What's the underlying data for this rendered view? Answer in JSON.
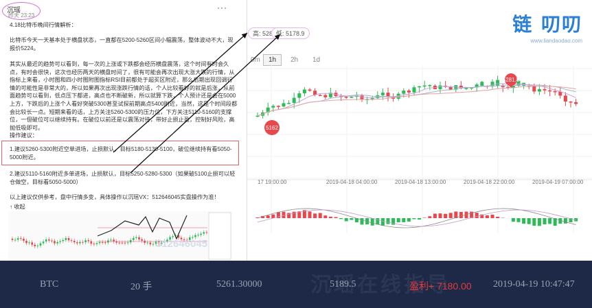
{
  "post": {
    "author": "沉瑶",
    "time": "昨天 23:23",
    "more": "···",
    "title": "4.18比特币晚间行情解析：",
    "para1": "比特币今天一天基本处于横盘状态，一直都在5200-5260区间小幅震荡，整体波动不大，现报价5224。",
    "para2": "其实从最近的趋势可以看到，每一次的上涨或下跌都会经历横盘震荡，这个时间有时会久点，有时会很快，这次也经历两天的横盘时间了，很有可能会再次出现大涨大跌的行情，从指标上来看，小时图和四小时图附图指标RSI目前都处于超买区附近，那么后期出现回调行情的可能性是非常大的，所以如果再次出现涨跌行情的话，个人比较看好的就是后涨，从前面趋势可以看到，低点压下都进，高点也不断破新，所以就算下跌，个人预计还是会在5000上方，下跌后的上涨个人看好突破5300甚至试探前期高点5400附近，当然，这是个时间段都会比较长一点。短期来看的话，上方关注5260-5300的压力位，下方关注5110-5160的支撑位，一但破位可以继续持有。在破位以前还是以震荡对待，带好止损止盈，控制好风险，高抛低吸即可。",
    "ops_title": "操作建议：",
    "op1": "1.建议5260-5300附近空单进场，止损默认，目标5180-5130-5100，破位继续持有看5050-5000附近。",
    "op2": "2.建议5110-5160附近多单进场，止损默认，目标5250-5280-5300（如果破5100止损可以轻仓做空，目标看5050-5000）",
    "footer": "以上建议仅供参考，盘中行情多变，具体操作以沉瑶VX：512646045实盘操作为准！",
    "collapse": "↑ 收起",
    "mini_watermark": "512646045"
  },
  "chart": {
    "brand_logo": "链 叨叨",
    "brand_url": "www.liandaodao.com",
    "stat_high": "高: 5285",
    "stat_low": "低: 5178.9",
    "timeframes": [
      "0m",
      "1h",
      "2h",
      "1d"
    ],
    "active_tf": "1h",
    "peak_label": "5281.8",
    "trough_label": "5162",
    "x_ticks": [
      "17 19:00:00",
      "2019-04-18 04:00:00",
      "2019-04-18 13:00:00",
      "2019-04-18 22:00:00",
      "2019-04-19 07:00:00"
    ],
    "up_color": "#2dbb58",
    "down_color": "#e8474c"
  },
  "bar": {
    "symbol": "BTC",
    "lots": "20 手",
    "entry": "5261.30000",
    "exit": "5189.5",
    "profit": "盈利+ 7180.00",
    "time": "2019-04-19 10:47:47",
    "watermark": "沉瑶在线指导"
  }
}
